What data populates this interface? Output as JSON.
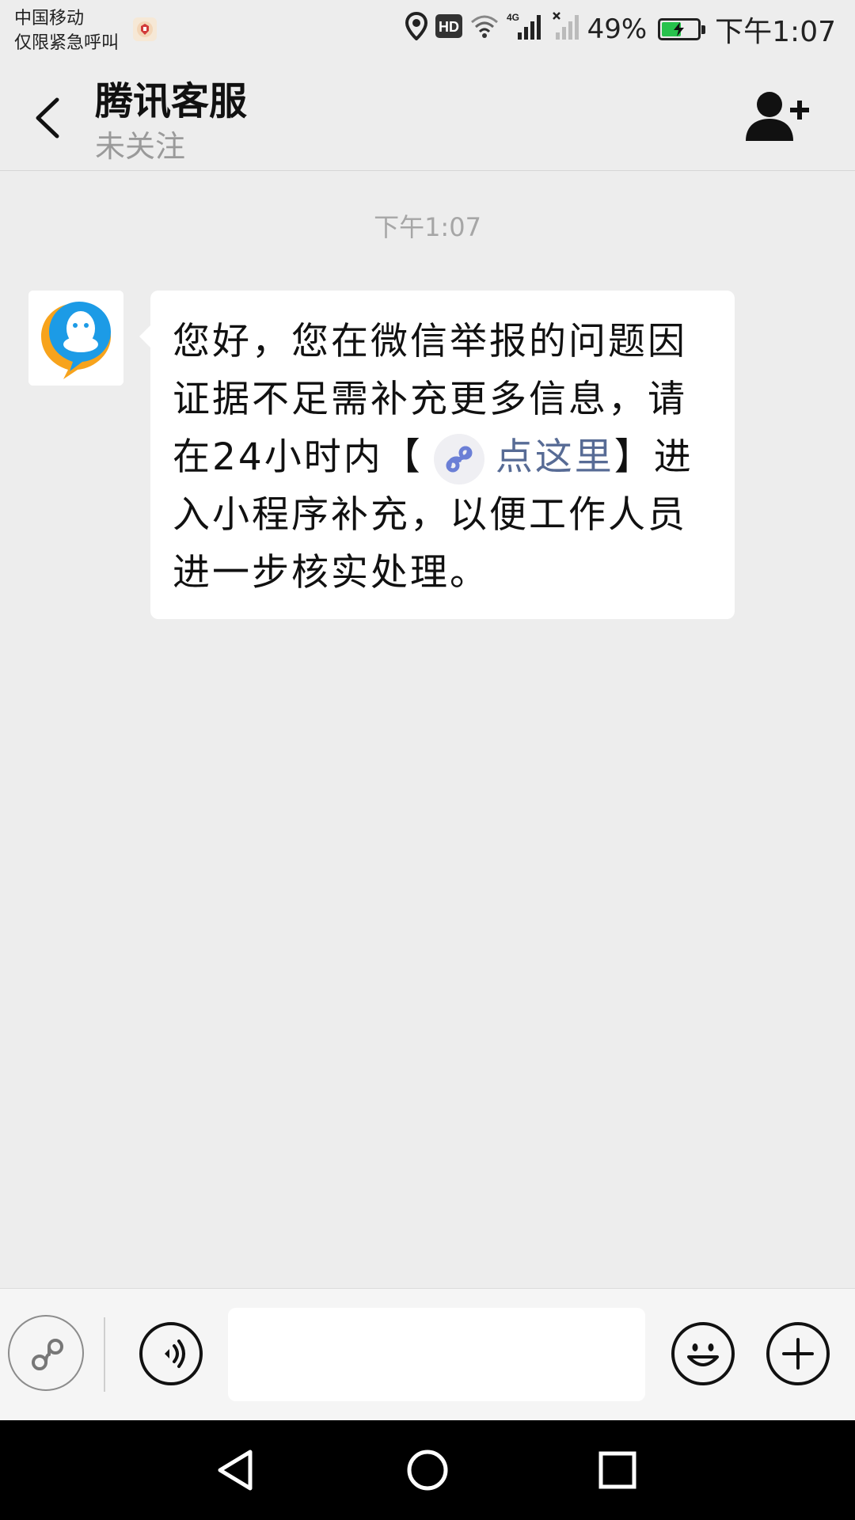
{
  "status_bar": {
    "carrier_line1": "中国移动",
    "carrier_line2": "仅限紧急呼叫",
    "hd_label": "HD",
    "network_label": "4G",
    "battery_percent": "49%",
    "battery_level": 0.49,
    "time": "下午1:07"
  },
  "header": {
    "title": "腾讯客服",
    "subtitle": "未关注",
    "back_icon": "chevron-left-icon",
    "add_icon": "add-contact-icon"
  },
  "chat": {
    "timestamp": "下午1:07",
    "messages": [
      {
        "sender": "腾讯客服",
        "text_before": "您好，您在微信举报的问题因证据不足需补充更多信息，请在24小时内【",
        "link_text": "点这里",
        "text_after": "】进入小程序补充，以便工作人员进一步核实处理。"
      }
    ]
  },
  "input_bar": {
    "input_value": "",
    "icons": [
      "mini-program-icon",
      "voice-icon",
      "emoji-icon",
      "plus-icon"
    ]
  },
  "nav_bar": {
    "icons": [
      "nav-back-icon",
      "nav-home-icon",
      "nav-recent-icon"
    ]
  },
  "colors": {
    "background": "#ededed",
    "bubble": "#ffffff",
    "link": "#576b95",
    "battery": "#27c24c"
  }
}
